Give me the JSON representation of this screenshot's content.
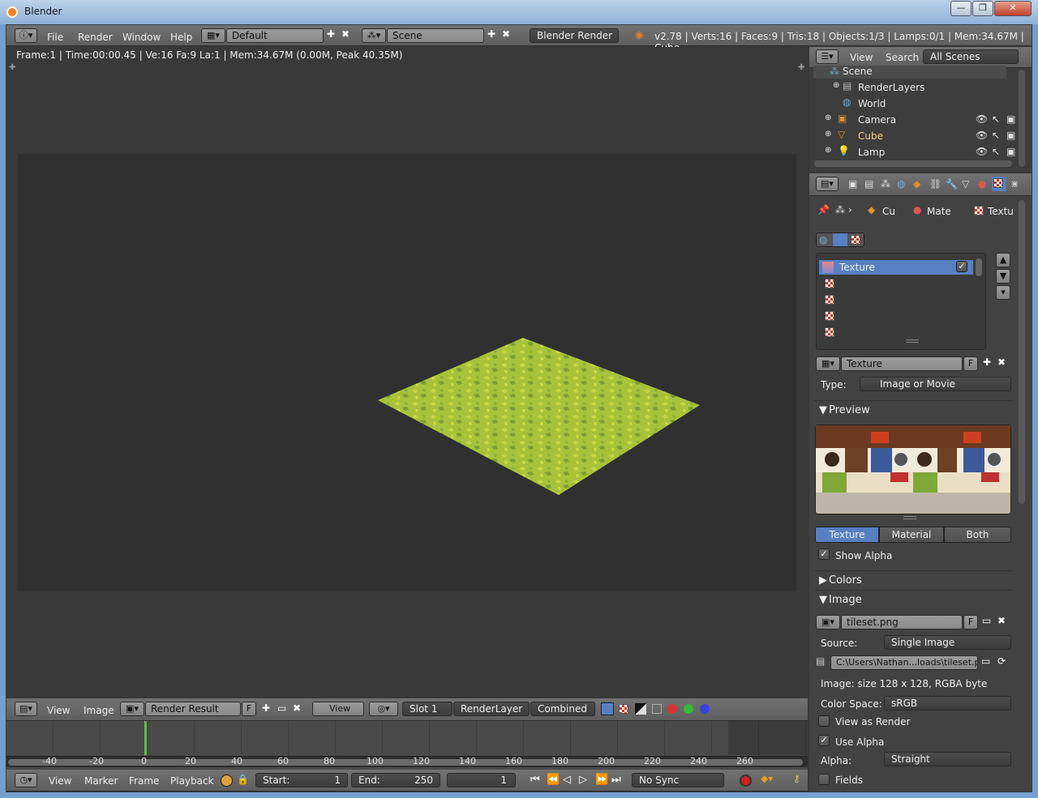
{
  "window": {
    "title": "Blender",
    "min": "—",
    "max": "❐",
    "close": "✕"
  },
  "info_header": {
    "menus": [
      "File",
      "Render",
      "Window",
      "Help"
    ],
    "layout": "Default",
    "scene": "Scene",
    "engine": "Blender Render",
    "stats": "v2.78 | Verts:16 | Faces:9 | Tris:18 | Objects:1/3 | Lamps:0/1 | Mem:34.67M | Cube"
  },
  "viewport": {
    "info": "Frame:1 | Time:00:00.45 | Ve:16 Fa:9 La:1 | Mem:34.67M (0.00M, Peak 40.35M)"
  },
  "image_header": {
    "menus": [
      "View",
      "Image"
    ],
    "image": "Render Result",
    "f": "F",
    "view": "View",
    "slot": "Slot 1",
    "layer": "RenderLayer",
    "pass": "Combined"
  },
  "timeline": {
    "ticks": [
      "-40",
      "-20",
      "0",
      "20",
      "40",
      "60",
      "80",
      "100",
      "120",
      "140",
      "160",
      "180",
      "200",
      "220",
      "240",
      "260"
    ],
    "menus": [
      "View",
      "Marker",
      "Frame",
      "Playback"
    ],
    "start_label": "Start:",
    "start": "1",
    "end_label": "End:",
    "end": "250",
    "current": "1",
    "sync": "No Sync",
    "current_frame_fraction": 0.0
  },
  "outliner": {
    "menus": [
      "View",
      "Search"
    ],
    "display": "All Scenes",
    "rows": [
      "Scene",
      "RenderLayers",
      "World",
      "Camera",
      "Cube",
      "Lamp"
    ]
  },
  "properties": {
    "breadcrumb": [
      "Cu",
      "Mate",
      "Textu"
    ],
    "texture_slots": [
      "Texture",
      "",
      "",
      "",
      "",
      ""
    ],
    "texture_name": "Texture",
    "f": "F",
    "type_label": "Type:",
    "type": "Image or Movie",
    "preview_label": "Preview",
    "preview_tabs": [
      "Texture",
      "Material",
      "Both"
    ],
    "show_alpha": "Show Alpha",
    "colors_label": "Colors",
    "image_label": "Image",
    "image_name": "tileset.png",
    "source_label": "Source:",
    "source": "Single Image",
    "path": "C:\\Users\\Nathan...loads\\tileset.png",
    "image_info": "Image: size 128 x 128, RGBA byte",
    "colorspace_label": "Color Space:",
    "colorspace": "sRGB",
    "view_as_render": "View as Render",
    "use_alpha": "Use Alpha",
    "alpha_label": "Alpha:",
    "alpha": "Straight",
    "fields": "Fields"
  },
  "colors": {
    "selected": "#5680c2",
    "grass": "#a8c23a"
  }
}
